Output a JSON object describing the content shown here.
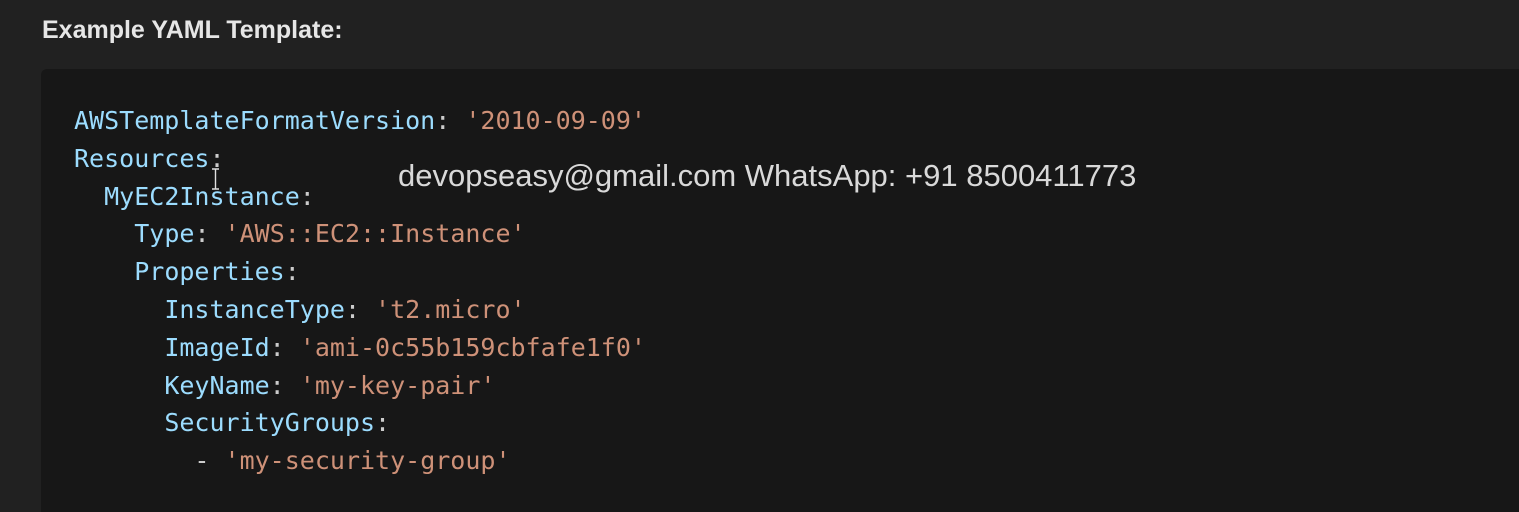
{
  "heading": "Example YAML Template:",
  "watermark": "devopseasy@gmail.com WhatsApp: +91 8500411773",
  "cursor_icon": "text-cursor-icon",
  "code_lines": [
    {
      "indent": "",
      "key": "AWSTemplateFormatVersion",
      "sep": ": ",
      "value": "'2010-09-09'"
    },
    {
      "indent": "",
      "key": "Resources",
      "sep": ":",
      "value": ""
    },
    {
      "indent": "  ",
      "key": "MyEC2Instance",
      "sep": ":",
      "value": ""
    },
    {
      "indent": "    ",
      "key": "Type",
      "sep": ": ",
      "value": "'AWS::EC2::Instance'"
    },
    {
      "indent": "    ",
      "key": "Properties",
      "sep": ":",
      "value": ""
    },
    {
      "indent": "      ",
      "key": "InstanceType",
      "sep": ": ",
      "value": "'t2.micro'"
    },
    {
      "indent": "      ",
      "key": "ImageId",
      "sep": ": ",
      "value": "'ami-0c55b159cbfafe1f0'"
    },
    {
      "indent": "      ",
      "key": "KeyName",
      "sep": ": ",
      "value": "'my-key-pair'"
    },
    {
      "indent": "      ",
      "key": "SecurityGroups",
      "sep": ":",
      "value": ""
    },
    {
      "indent": "        ",
      "key": "",
      "sep": "- ",
      "value": "'my-security-group'"
    }
  ],
  "colors": {
    "background": "#212121",
    "code_background": "#171717",
    "key": "#9cdcfe",
    "string": "#ce9178",
    "text": "#e6e6e6"
  }
}
